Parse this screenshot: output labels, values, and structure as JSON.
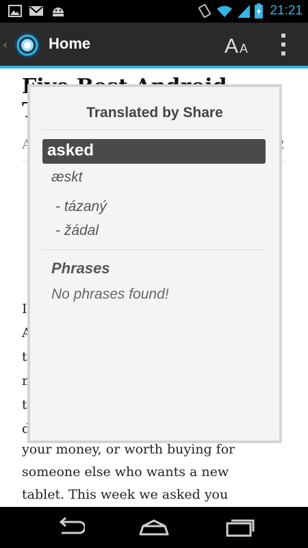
{
  "status_bar": {
    "time": "21:21",
    "left_icons": [
      "picture-notification-icon",
      "gmail-notification-icon",
      "android-notification-icon"
    ],
    "right_icons": [
      "screen-rotation-icon",
      "wifi-icon",
      "signal-icon",
      "battery-charging-icon"
    ],
    "accent_color": "#33b5e5"
  },
  "action_bar": {
    "title": "Home",
    "font_size_button": {
      "big": "A",
      "small": "A"
    }
  },
  "article": {
    "title_line_1": "Five Best Android",
    "title_line_2": "T",
    "meta_left": "A",
    "meta_right": "2",
    "body_fragments": [
      "If",
      "A",
      "th",
      "m",
      "th",
      "d"
    ],
    "body_lines": [
      "your money, or worth buying for",
      "someone else who wants a new",
      "tablet. This week we asked you"
    ]
  },
  "dialog": {
    "title": "Translated by Share",
    "word": "asked",
    "pronunciation": "æskt",
    "translations": [
      "- tázaný",
      "- žádal"
    ],
    "phrases_heading": "Phrases",
    "phrases_empty": "No phrases found!"
  },
  "nav_bar": {
    "icons": [
      "back-icon",
      "home-icon",
      "recent-apps-icon"
    ]
  }
}
